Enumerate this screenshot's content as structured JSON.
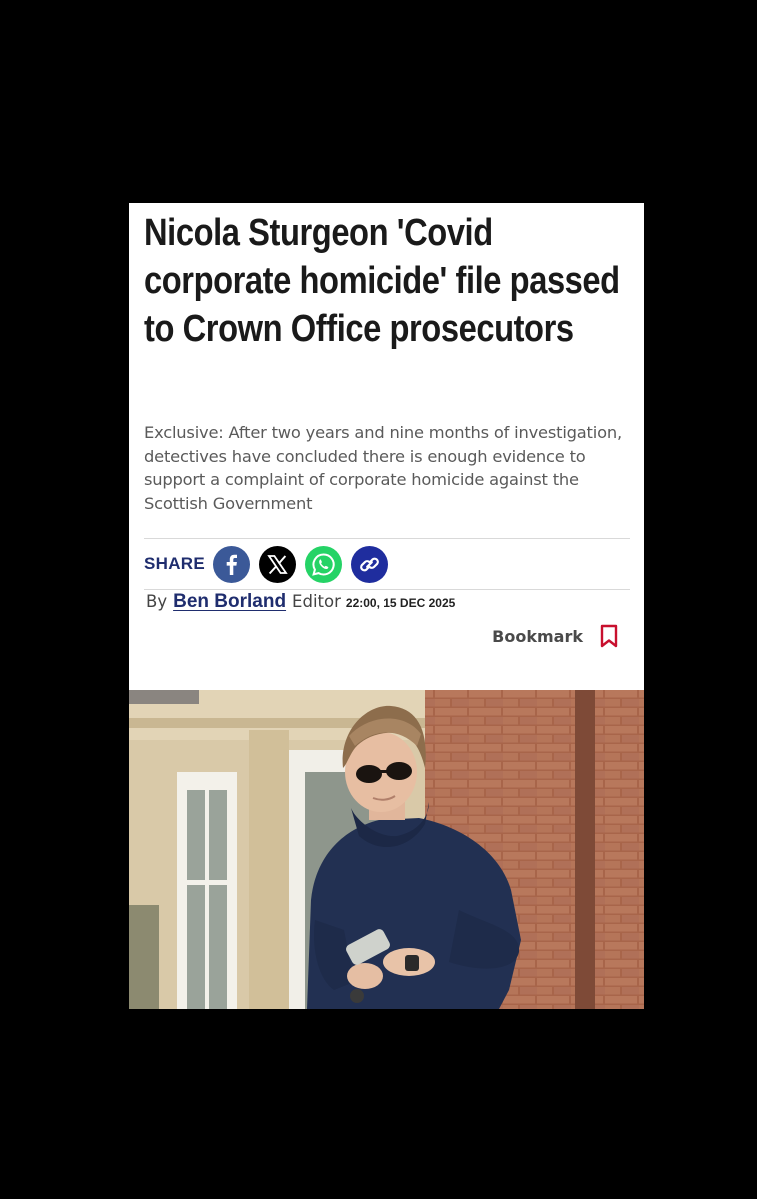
{
  "article": {
    "headline": "Nicola Sturgeon 'Covid corporate homicide' file passed to Crown Office prosecutors",
    "standfirst": "Exclusive: After two years and nine months of investigation, detectives have concluded there is enough evidence to support a complaint of corporate homicide against the Scottish Government"
  },
  "share": {
    "label": "SHARE",
    "buttons": [
      {
        "name": "facebook",
        "icon": "facebook-icon",
        "color": "#3b5998"
      },
      {
        "name": "x",
        "icon": "x-icon",
        "color": "#000000"
      },
      {
        "name": "whatsapp",
        "icon": "whatsapp-icon",
        "color": "#25d366"
      },
      {
        "name": "copy-link",
        "icon": "link-icon",
        "color": "#1f2d9e"
      }
    ]
  },
  "byline": {
    "prefix": "By",
    "author": "Ben Borland",
    "role": "Editor",
    "timestamp": "22:00, 15 DEC 2025"
  },
  "bookmark": {
    "label": "Bookmark",
    "icon": "bookmark-icon",
    "color": "#c8102e"
  },
  "colors": {
    "background": "#000000",
    "brand_navy": "#1f2d6e",
    "headline": "#1a1a1a"
  }
}
